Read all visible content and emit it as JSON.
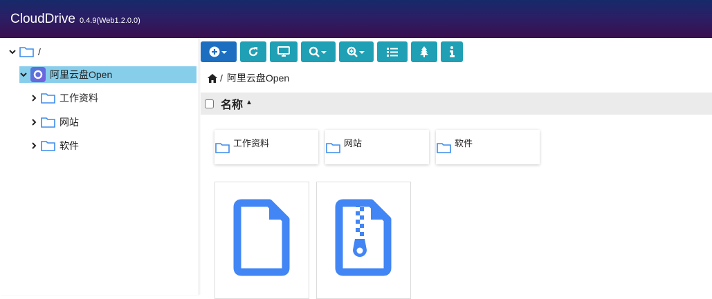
{
  "header": {
    "title": "CloudDrive",
    "version": "0.4.9(Web1.2.0.0)"
  },
  "tree": {
    "root": {
      "label": "/"
    },
    "drive": {
      "label": "阿里云盘Open"
    },
    "children": [
      {
        "label": "工作资料"
      },
      {
        "label": "网站"
      },
      {
        "label": "软件"
      }
    ]
  },
  "toolbar": {
    "buttons": [
      {
        "icon": "add-icon",
        "style": "primary",
        "has_dropdown": true
      },
      {
        "icon": "refresh-icon",
        "style": "info",
        "has_dropdown": false
      },
      {
        "icon": "monitor-icon",
        "style": "info",
        "has_dropdown": false
      },
      {
        "icon": "search-icon",
        "style": "info",
        "has_dropdown": true
      },
      {
        "icon": "zoom-in-icon",
        "style": "info",
        "has_dropdown": true
      },
      {
        "icon": "list-icon",
        "style": "info",
        "has_dropdown": false
      },
      {
        "icon": "tree-icon",
        "style": "info",
        "has_dropdown": false
      },
      {
        "icon": "info-icon",
        "style": "info",
        "has_dropdown": false
      }
    ]
  },
  "breadcrumb": {
    "separator": "/",
    "current": "阿里云盘Open"
  },
  "list": {
    "column_name": "名称",
    "folders": [
      {
        "name": "工作资料"
      },
      {
        "name": "网站"
      },
      {
        "name": "软件"
      }
    ],
    "files": [
      {
        "icon": "file-icon"
      },
      {
        "icon": "zip-file-icon"
      }
    ]
  },
  "colors": {
    "primary": "#1c6fc0",
    "info": "#1fa0b4",
    "folder": "#3b8beb",
    "selected": "#87ceeb",
    "file": "#4285f4"
  }
}
